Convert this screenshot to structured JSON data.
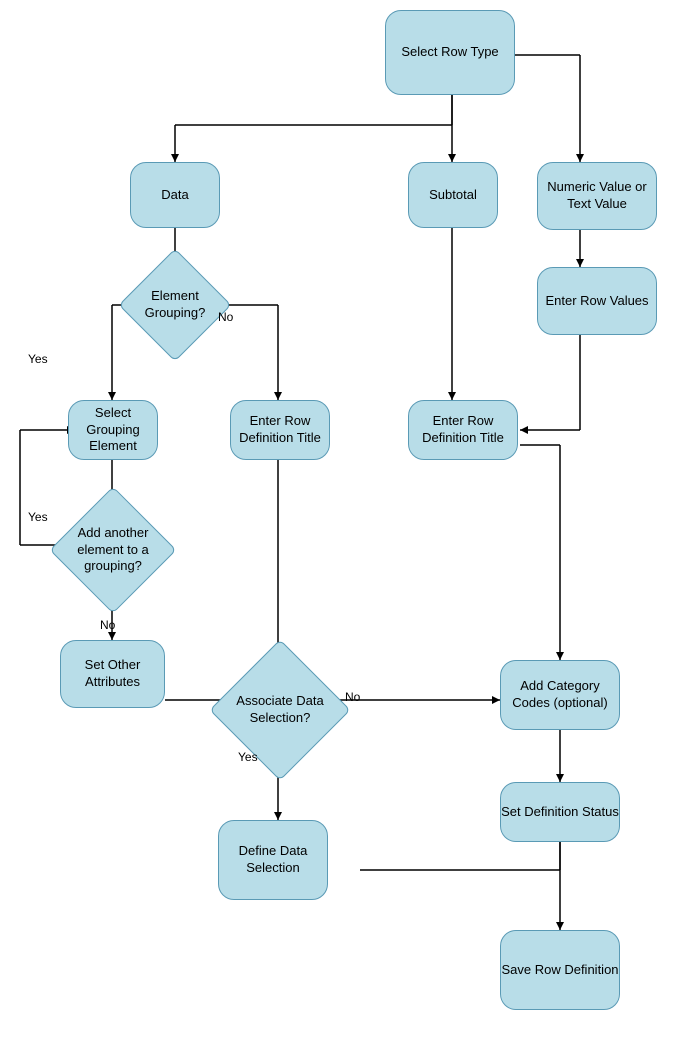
{
  "nodes": {
    "select_row_type": {
      "label": "Select Row\nType"
    },
    "data": {
      "label": "Data"
    },
    "subtotal": {
      "label": "Subtotal"
    },
    "numeric_text": {
      "label": "Numeric Value\nor Text Value"
    },
    "enter_row_values": {
      "label": "Enter Row\nValues"
    },
    "element_grouping": {
      "label": "Element\nGrouping?"
    },
    "select_grouping": {
      "label": "Select\nGrouping\nElement"
    },
    "enter_row_def_left": {
      "label": "Enter Row\nDefinition Title"
    },
    "enter_row_def_right": {
      "label": "Enter Row\nDefinition Title"
    },
    "add_another": {
      "label": "Add another\nelement to a\ngrouping?"
    },
    "set_other": {
      "label": "Set Other\nAttributes"
    },
    "associate_data": {
      "label": "Associate Data\nSelection?"
    },
    "define_data": {
      "label": "Define Data\nSelection"
    },
    "add_category": {
      "label": "Add Category\nCodes\n(optional)"
    },
    "set_definition": {
      "label": "Set Definition\nStatus"
    },
    "save_row": {
      "label": "Save Row\nDefinition"
    }
  },
  "labels": {
    "yes1": "Yes",
    "no1": "No",
    "yes2": "Yes",
    "no2": "No",
    "yes3": "Yes",
    "no3": "No"
  }
}
